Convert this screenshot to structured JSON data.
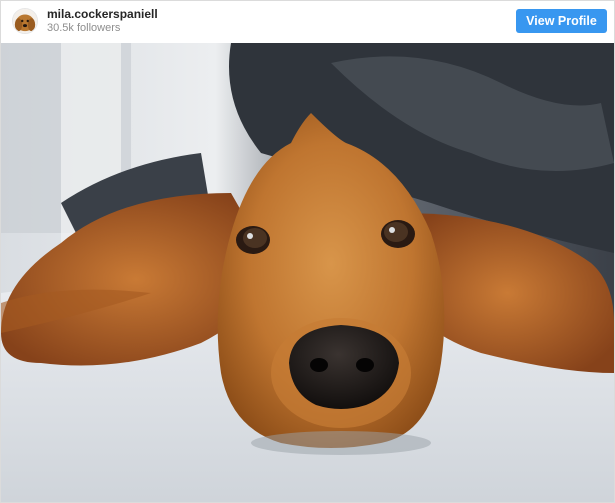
{
  "profile": {
    "username": "mila.cockerspaniell",
    "followers": "30.5k followers",
    "avatar_icon": "dog-avatar-icon"
  },
  "actions": {
    "view_profile_label": "View Profile"
  },
  "post": {
    "image": "cocker-spaniel-photo"
  },
  "colors": {
    "accent": "#3897f0",
    "username": "#262626",
    "muted": "#8e8e8e",
    "border": "#dbdbdb"
  }
}
